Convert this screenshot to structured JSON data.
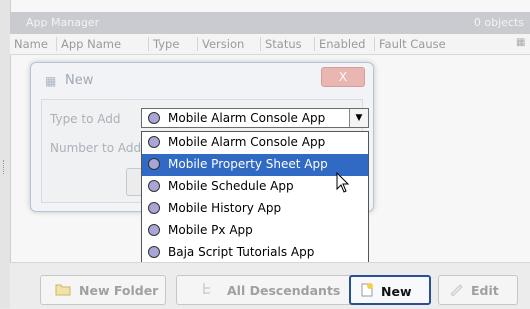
{
  "manager": {
    "title": "App Manager",
    "count": "0 objects"
  },
  "columns": [
    "Name",
    "App Name",
    "Type",
    "Version",
    "Status",
    "Enabled",
    "Fault Cause"
  ],
  "dialog": {
    "title": "New",
    "close_label": "X",
    "type_label": "Type to Add",
    "number_label": "Number to Add"
  },
  "combo": {
    "selected": "Mobile Alarm Console App"
  },
  "dropdown": {
    "options": [
      "Mobile Alarm Console App",
      "Mobile Property Sheet App",
      "Mobile Schedule App",
      "Mobile History App",
      "Mobile Px App",
      "Baja Script Tutorials App"
    ],
    "highlighted": "Mobile Property Sheet App"
  },
  "toolbar": {
    "new_folder": "New Folder",
    "all_descendants": "All Descendants",
    "new": "New",
    "edit": "Edit"
  },
  "colors": {
    "selection": "#316ac5",
    "active_border": "#2b4f93"
  }
}
